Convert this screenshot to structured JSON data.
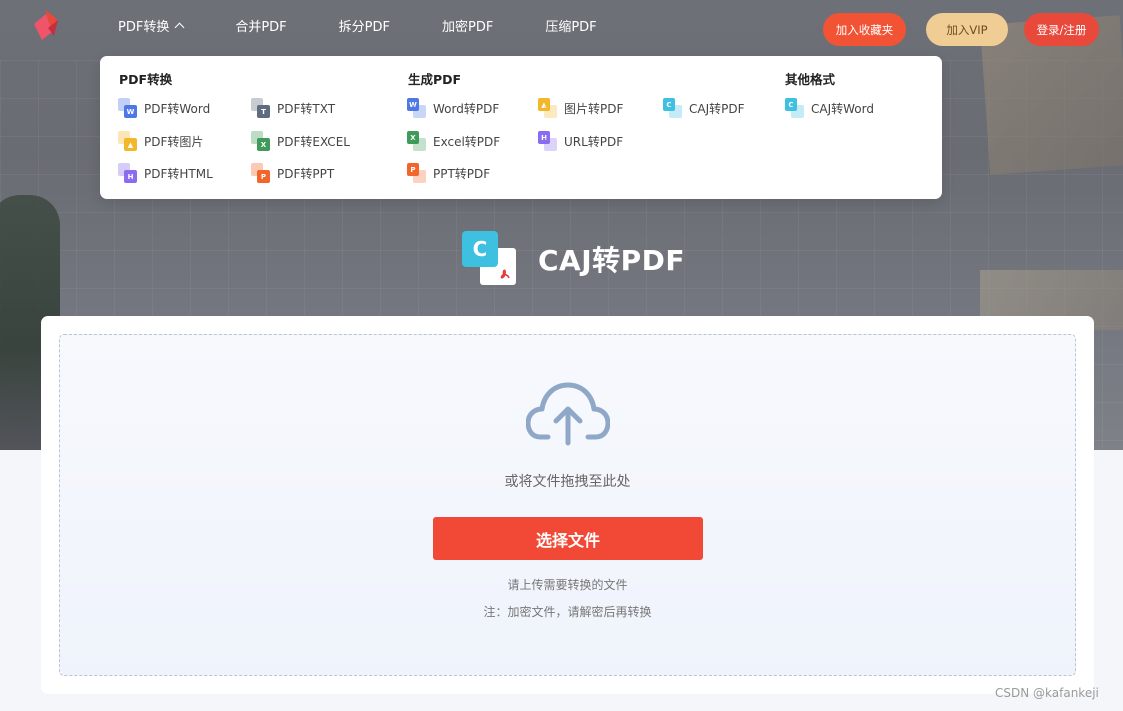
{
  "nav": {
    "items": [
      "PDF转换",
      "合并PDF",
      "拆分PDF",
      "加密PDF",
      "压缩PDF"
    ],
    "favorite_label": "加入收藏夹",
    "vip_label": "加入VIP",
    "login_label": "登录/注册"
  },
  "dropdown": {
    "groups": [
      {
        "title": "PDF转换"
      },
      {
        "title": "生成PDF"
      },
      {
        "title": "其他格式"
      }
    ],
    "items": [
      {
        "label": "PDF转Word",
        "badge": "W",
        "color": "#4f78e6"
      },
      {
        "label": "PDF转TXT",
        "badge": "T",
        "color": "#5f6b7e"
      },
      {
        "label": "PDF转图片",
        "badge": "",
        "color": "#f3b72b"
      },
      {
        "label": "PDF转EXCEL",
        "badge": "X",
        "color": "#3f9a5b"
      },
      {
        "label": "PDF转HTML",
        "badge": "H",
        "color": "#8a6cf0"
      },
      {
        "label": "PDF转PPT",
        "badge": "P",
        "color": "#f2662c"
      },
      {
        "label": "Word转PDF",
        "badge": "W",
        "color": "#4f78e6"
      },
      {
        "label": "图片转PDF",
        "badge": "",
        "color": "#f3b72b"
      },
      {
        "label": "CAJ转PDF",
        "badge": "C",
        "color": "#3ec0e0"
      },
      {
        "label": "Excel转PDF",
        "badge": "X",
        "color": "#3f9a5b"
      },
      {
        "label": "URL转PDF",
        "badge": "H",
        "color": "#8a6cf0"
      },
      {
        "label": "PPT转PDF",
        "badge": "P",
        "color": "#f2662c"
      },
      {
        "label": "CAJ转Word",
        "badge": "C",
        "color": "#3ec0e0"
      }
    ]
  },
  "hero": {
    "title": "CAJ转PDF",
    "icon_letter": "C"
  },
  "upload": {
    "drag_text": "或将文件拖拽至此处",
    "button_label": "选择文件",
    "hint": "请上传需要转换的文件",
    "note": "注：加密文件，请解密后再转换"
  },
  "watermark": "CSDN @kafankeji",
  "colors": {
    "primary": "#f14935",
    "vip": "#f0cd94",
    "cloud": "#8fa8c8"
  }
}
